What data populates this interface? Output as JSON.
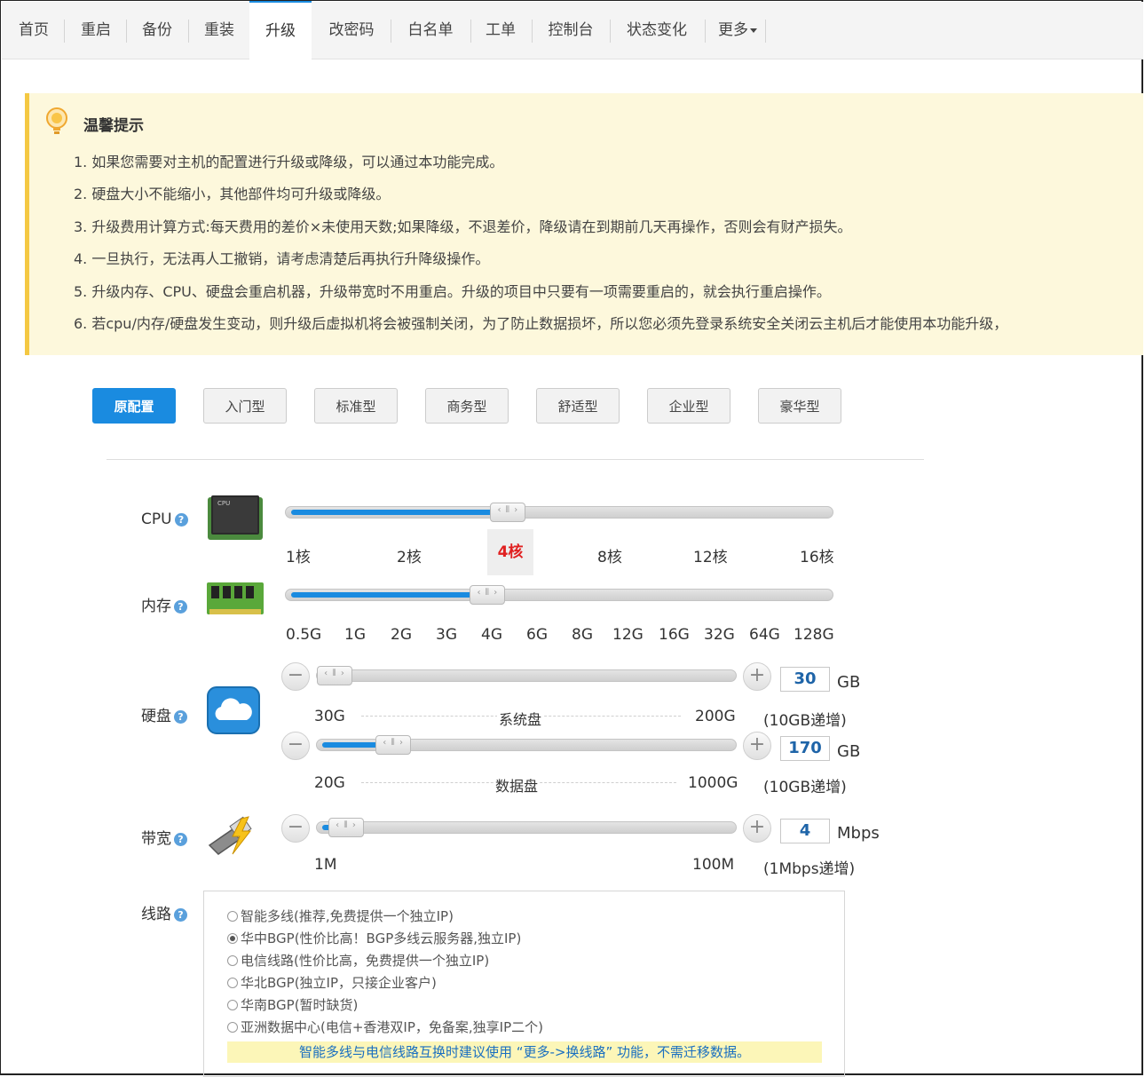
{
  "nav": {
    "items": [
      {
        "label": "首页"
      },
      {
        "label": "重启"
      },
      {
        "label": "备份"
      },
      {
        "label": "重装"
      },
      {
        "label": "升级"
      },
      {
        "label": "改密码"
      },
      {
        "label": "白名单"
      },
      {
        "label": "工单"
      },
      {
        "label": "控制台"
      },
      {
        "label": "状态变化"
      },
      {
        "label": "更多"
      }
    ],
    "active": "升级"
  },
  "tip": {
    "title": "温馨提示",
    "items": [
      "1.  如果您需要对主机的配置进行升级或降级，可以通过本功能完成。",
      "2.  硬盘大小不能缩小，其他部件均可升级或降级。",
      "3.  升级费用计算方式:每天费用的差价×未使用天数;如果降级，不退差价，降级请在到期前几天再操作，否则会有财产损失。",
      "4.  一旦执行，无法再人工撤销，请考虑清楚后再执行升降级操作。",
      "5.  升级内存、CPU、硬盘会重启机器，升级带宽时不用重启。升级的项目中只要有一项需要重启的，就会执行重启操作。",
      "6.  若cpu/内存/硬盘发生变动，则升级后虚拟机将会被强制关闭，为了防止数据损坏，所以您必须先登录系统安全关闭云主机后才能使用本功能升级，"
    ]
  },
  "presets": {
    "items": [
      "原配置",
      "入门型",
      "标准型",
      "商务型",
      "舒适型",
      "企业型",
      "豪华型"
    ],
    "active": "原配置"
  },
  "cpu": {
    "label": "CPU",
    "help": "?",
    "ticks": [
      "1核",
      "2核",
      "4核",
      "8核",
      "12核",
      "16核"
    ],
    "selected": "4核",
    "level": 0.4
  },
  "memory": {
    "label": "内存",
    "help": "?",
    "ticks": [
      "0.5G",
      "1G",
      "2G",
      "3G",
      "4G",
      "6G",
      "8G",
      "12G",
      "16G",
      "32G",
      "64G",
      "128G"
    ],
    "level": 0.36
  },
  "disk": {
    "label": "硬盘",
    "help": "?",
    "minus": "−",
    "plus": "+",
    "system": {
      "min": "30G",
      "name": "系统盘",
      "max": "200G",
      "value": "30",
      "unit": "GB",
      "step": "(10GB递增)",
      "level": 0.0
    },
    "data": {
      "min": "20G",
      "name": "数据盘",
      "max": "1000G",
      "value": "170",
      "unit": "GB",
      "step": "(10GB递增)",
      "level": 0.153
    }
  },
  "bandwidth": {
    "label": "带宽",
    "help": "?",
    "minus": "−",
    "plus": "+",
    "min": "1M",
    "max": "100M",
    "value": "4",
    "unit": "Mbps",
    "step": "(1Mbps递增)",
    "level": 0.03
  },
  "route": {
    "label": "线路",
    "help": "?",
    "options": [
      "智能多线(推荐,免费提供一个独立IP)",
      "华中BGP(性价比高！BGP多线云服务器,独立IP)",
      "电信线路(性价比高，免费提供一个独立IP)",
      "华北BGP(独立IP，只接企业客户)",
      "华南BGP(暂时缺货)",
      "亚洲数据中心(电信+香港双IP，免备案,独享IP二个)"
    ],
    "selected": 1,
    "note": "智能多线与电信线路互换时建议使用 “更多->换线路” 功能，不需迁移数据。"
  },
  "colors": {
    "accent": "#1a8be0",
    "tip_bg": "#fdf8dc",
    "tip_border": "#f4c842",
    "selected_tick": "#e02020"
  }
}
